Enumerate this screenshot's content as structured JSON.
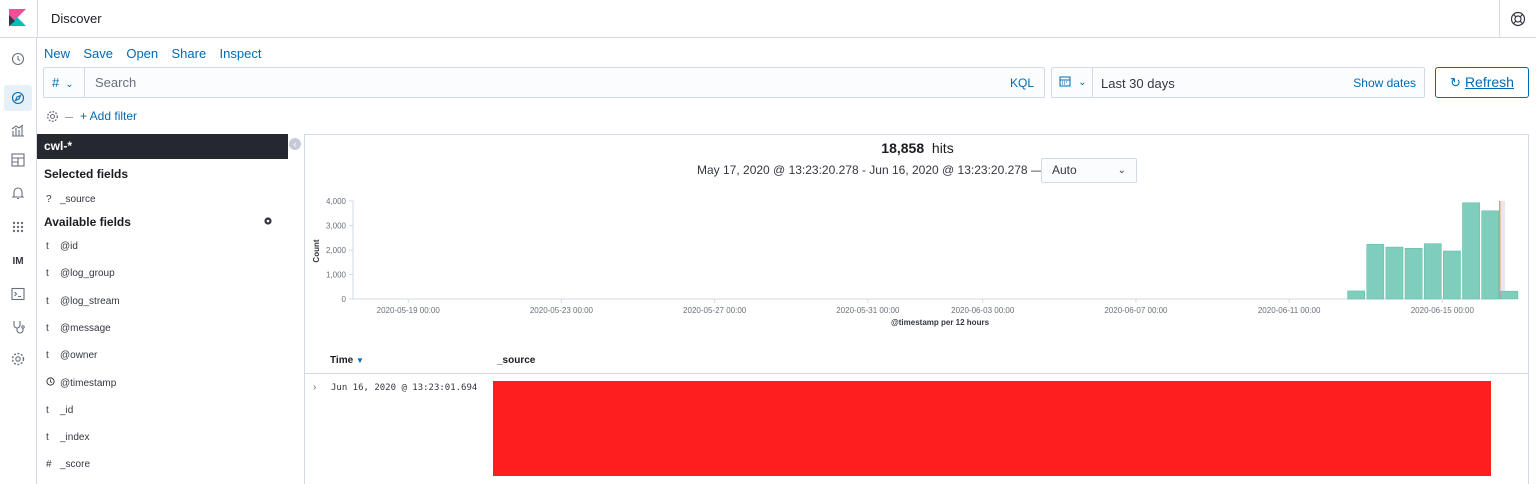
{
  "header": {
    "app_title": "Discover"
  },
  "nav": {
    "items": [
      "clock-icon",
      "compass-icon",
      "visualize-icon",
      "dashboard-icon",
      "alerting-icon",
      "apps-grid-icon",
      "IM",
      "console-icon",
      "stethoscope-icon",
      "gear-icon"
    ]
  },
  "top_menu": {
    "new": "New",
    "save": "Save",
    "open": "Open",
    "share": "Share",
    "inspect": "Inspect"
  },
  "query": {
    "lang_symbol": "#",
    "placeholder": "Search",
    "kql": "KQL"
  },
  "date_picker": {
    "range": "Last 30 days",
    "show_dates": "Show dates"
  },
  "refresh": {
    "label": "Refresh"
  },
  "filter": {
    "add_filter": "+ Add filter"
  },
  "sidebar": {
    "index_pattern": "cwl-*",
    "selected_title": "Selected fields",
    "selected_fields": [
      {
        "type": "?",
        "name": "_source"
      }
    ],
    "available_title": "Available fields",
    "available_fields": [
      {
        "type": "t",
        "name": "@id"
      },
      {
        "type": "t",
        "name": "@log_group"
      },
      {
        "type": "t",
        "name": "@log_stream"
      },
      {
        "type": "t",
        "name": "@message"
      },
      {
        "type": "t",
        "name": "@owner"
      },
      {
        "type": "clock",
        "name": "@timestamp"
      },
      {
        "type": "t",
        "name": "_id"
      },
      {
        "type": "t",
        "name": "_index"
      },
      {
        "type": "#",
        "name": "_score"
      }
    ]
  },
  "results": {
    "hits_count": "18,858",
    "hits_label": "hits",
    "time_range": "May 17, 2020 @ 13:23:20.278 - Jun 16, 2020 @ 13:23:20.278 —",
    "interval": "Auto"
  },
  "chart_data": {
    "type": "bar",
    "ylabel": "Count",
    "xlabel": "@timestamp per 12 hours",
    "ylim": [
      0,
      4000
    ],
    "yticks": [
      "0",
      "1,000",
      "2,000",
      "3,000",
      "4,000"
    ],
    "xticks": [
      "2020-05-19 00:00",
      "2020-05-23 00:00",
      "2020-05-27 00:00",
      "2020-05-31 00:00",
      "2020-06-03 00:00",
      "2020-06-07 00:00",
      "2020-06-11 00:00",
      "2020-06-15 00:00"
    ],
    "bars": [
      {
        "x": "2020-06-12 12:00",
        "value": 330
      },
      {
        "x": "2020-06-13 00:00",
        "value": 2230
      },
      {
        "x": "2020-06-13 12:00",
        "value": 2120
      },
      {
        "x": "2020-06-14 00:00",
        "value": 2070
      },
      {
        "x": "2020-06-14 12:00",
        "value": 2260
      },
      {
        "x": "2020-06-15 00:00",
        "value": 1960
      },
      {
        "x": "2020-06-15 12:00",
        "value": 3930
      },
      {
        "x": "2020-06-16 00:00",
        "value": 3600
      },
      {
        "x": "2020-06-16 12:00",
        "value": 320
      }
    ],
    "bar_color": "#7fcdbb",
    "grid": false
  },
  "table": {
    "col_time": "Time",
    "col_source": "_source",
    "rows": [
      {
        "time": "Jun 16, 2020 @ 13:23:01.694",
        "source_redacted": true
      }
    ]
  },
  "colors": {
    "accent": "#006bb4",
    "index_bg": "#25282f",
    "redaction": "#ff1f1f"
  }
}
